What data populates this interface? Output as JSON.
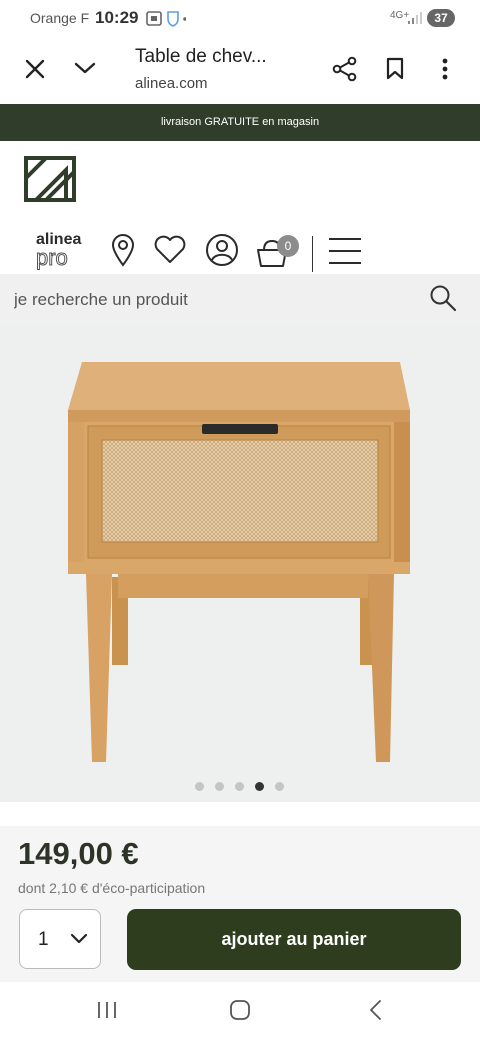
{
  "status_bar": {
    "carrier": "Orange F",
    "time": "10:29",
    "network": "4G+",
    "battery": "37"
  },
  "browser": {
    "title": "Table de chev...",
    "url": "alinea.com",
    "icons": [
      "close-icon",
      "chevron-down-icon",
      "share-icon",
      "bookmark-icon",
      "more-vertical-icon"
    ]
  },
  "promo": {
    "text": "livraison GRATUITE en magasin",
    "bg": "#2f3d2a"
  },
  "header": {
    "pro_logo_top": "alinea",
    "pro_logo_bottom": "pro",
    "cart_count": "0",
    "icons": [
      "store-location-icon",
      "heart-icon",
      "account-icon",
      "cart-icon",
      "menu-icon"
    ]
  },
  "search": {
    "placeholder": "je recherche un produit"
  },
  "gallery": {
    "slide_count": 5,
    "active_slide": 4
  },
  "product": {
    "price": "149,00 €",
    "eco": "dont 2,10 € d'éco-participation",
    "quantity": "1",
    "add_to_cart": "ajouter au panier",
    "accent": "#2f3d1f"
  }
}
